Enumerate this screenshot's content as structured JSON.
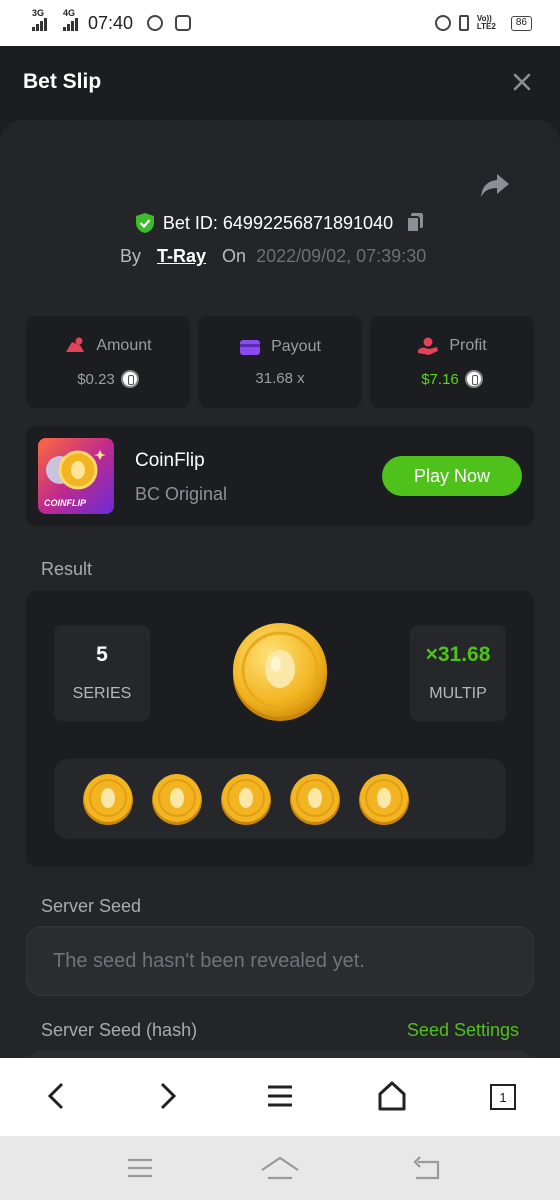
{
  "status_bar": {
    "net1": "3G",
    "net2": "4G",
    "time": "07:40",
    "volte": "Vo)) LTE2",
    "battery": "86"
  },
  "header": {
    "title": "Bet Slip"
  },
  "bet": {
    "bet_id_label": "Bet ID: 64992256871891040",
    "by_label": "By",
    "user": "T-Ray",
    "on_label": "On",
    "date": "2022/09/02, 07:39:30"
  },
  "stats": [
    {
      "label": "Amount",
      "value": "$0.23",
      "icon": "amount-icon"
    },
    {
      "label": "Payout",
      "value": "31.68 x",
      "icon": "wallet-icon"
    },
    {
      "label": "Profit",
      "value": "$7.16",
      "icon": "profit-icon"
    }
  ],
  "game": {
    "thumb_label": "COINFLIP",
    "name": "CoinFlip",
    "subtitle": "BC Original",
    "play_label": "Play Now"
  },
  "result": {
    "section_label": "Result",
    "series_value": "5",
    "series_label": "SERIES",
    "multiplier_value": "×31.68",
    "multiplier_label": "MULTIP",
    "coin_count": 5
  },
  "server_seed": {
    "label": "Server Seed",
    "value": "The seed hasn't been revealed yet."
  },
  "server_seed_hash": {
    "label": "Server Seed (hash)",
    "settings_label": "Seed Settings"
  },
  "browser_nav": {
    "tab_count": "1"
  },
  "colors": {
    "accent_green": "#4fc11b",
    "panel_bg": "#232528",
    "card_bg": "#1b1d20",
    "coin_gold": "#f2b521"
  }
}
